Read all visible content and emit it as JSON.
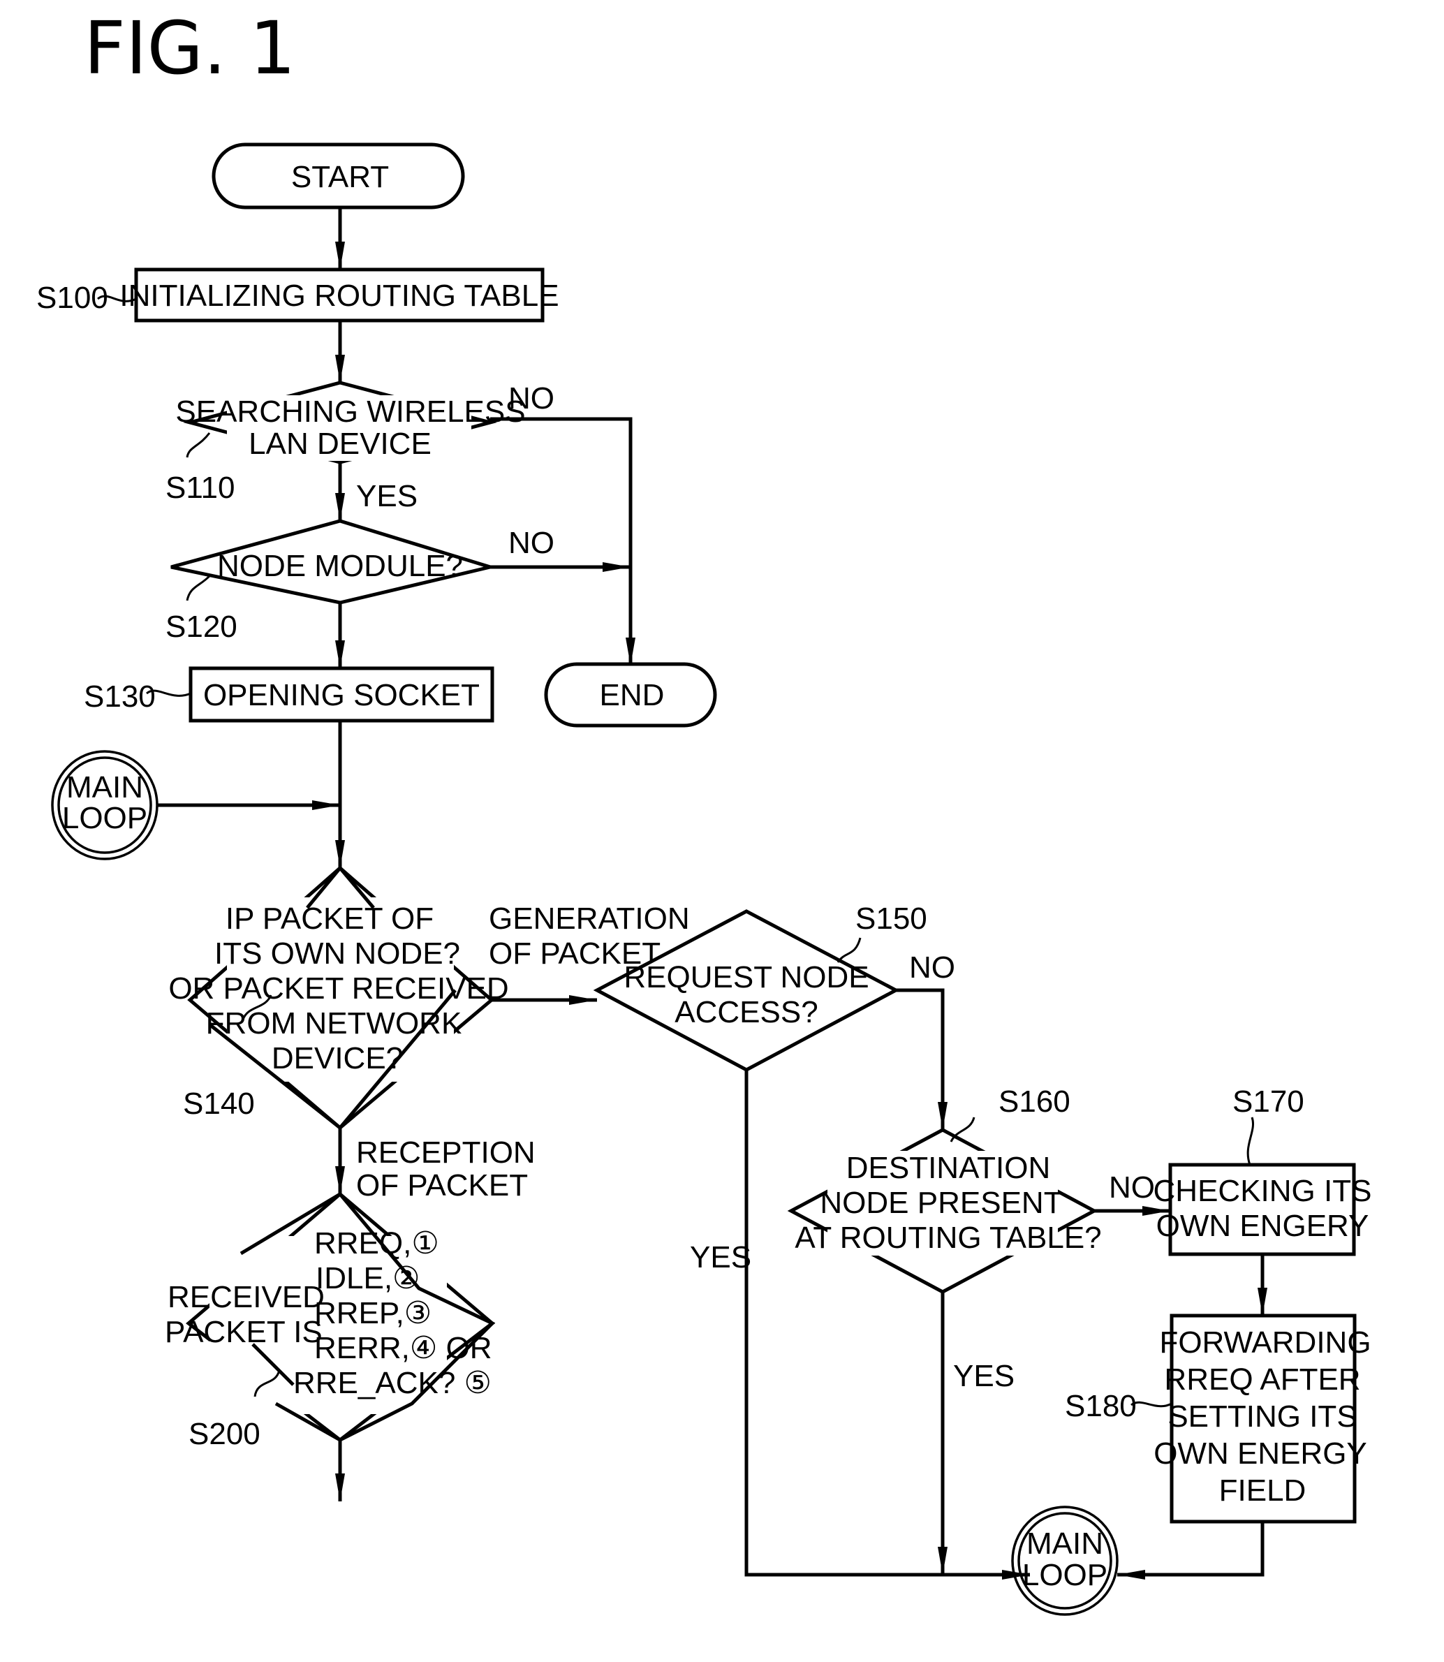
{
  "figure": {
    "title": "FIG. 1"
  },
  "nodes": {
    "start": {
      "text": "START"
    },
    "s100": {
      "ref": "S100",
      "lines": [
        "INITIALIZING ROUTING TABLE"
      ]
    },
    "s110": {
      "ref": "S110",
      "lines": [
        "SEARCHING WIRELESS",
        "LAN DEVICE"
      ]
    },
    "s120": {
      "ref": "S120",
      "lines": [
        "NODE MODULE?"
      ]
    },
    "s130": {
      "ref": "S130",
      "lines": [
        "OPENING SOCKET"
      ]
    },
    "end": {
      "text": "END"
    },
    "main_loop_left": {
      "lines": [
        "MAIN",
        "LOOP"
      ]
    },
    "s140": {
      "ref": "S140",
      "lines": [
        "IP PACKET OF",
        "ITS OWN NODE?",
        "OR PACKET RECEIVED",
        "FROM NETWORK",
        "DEVICE?"
      ]
    },
    "s150": {
      "ref": "S150",
      "lines": [
        "REQUEST NODE",
        "ACCESS?"
      ]
    },
    "s160": {
      "ref": "S160",
      "lines": [
        "DESTINATION",
        "NODE PRESENT",
        "AT ROUTING TABLE?"
      ]
    },
    "s170": {
      "ref": "S170",
      "lines": [
        "CHECKING ITS",
        "OWN ENGERY"
      ]
    },
    "s180": {
      "ref": "S180",
      "lines": [
        "FORWARDING",
        "RREQ AFTER",
        "SETTING ITS",
        "OWN ENERGY",
        "FIELD"
      ]
    },
    "s200": {
      "ref": "S200",
      "side_lines": [
        "RECEIVED",
        "PACKET IS"
      ],
      "lines": [
        "RREQ,①",
        "IDLE,②",
        "RREP,③",
        "RERR,④ OR",
        "RRE_ACK? ⑤"
      ]
    },
    "main_loop_bottom": {
      "lines": [
        "MAIN",
        "LOOP"
      ]
    }
  },
  "edge_labels": {
    "s110_no": "NO",
    "s110_yes": "YES",
    "s120_no": "NO",
    "s140_generation": [
      "GENERATION",
      "OF PACKET"
    ],
    "s140_reception": [
      "RECEPTION",
      "OF PACKET"
    ],
    "s150_no": "NO",
    "s150_yes": "YES",
    "s160_no": "NO",
    "s160_yes": "YES"
  }
}
